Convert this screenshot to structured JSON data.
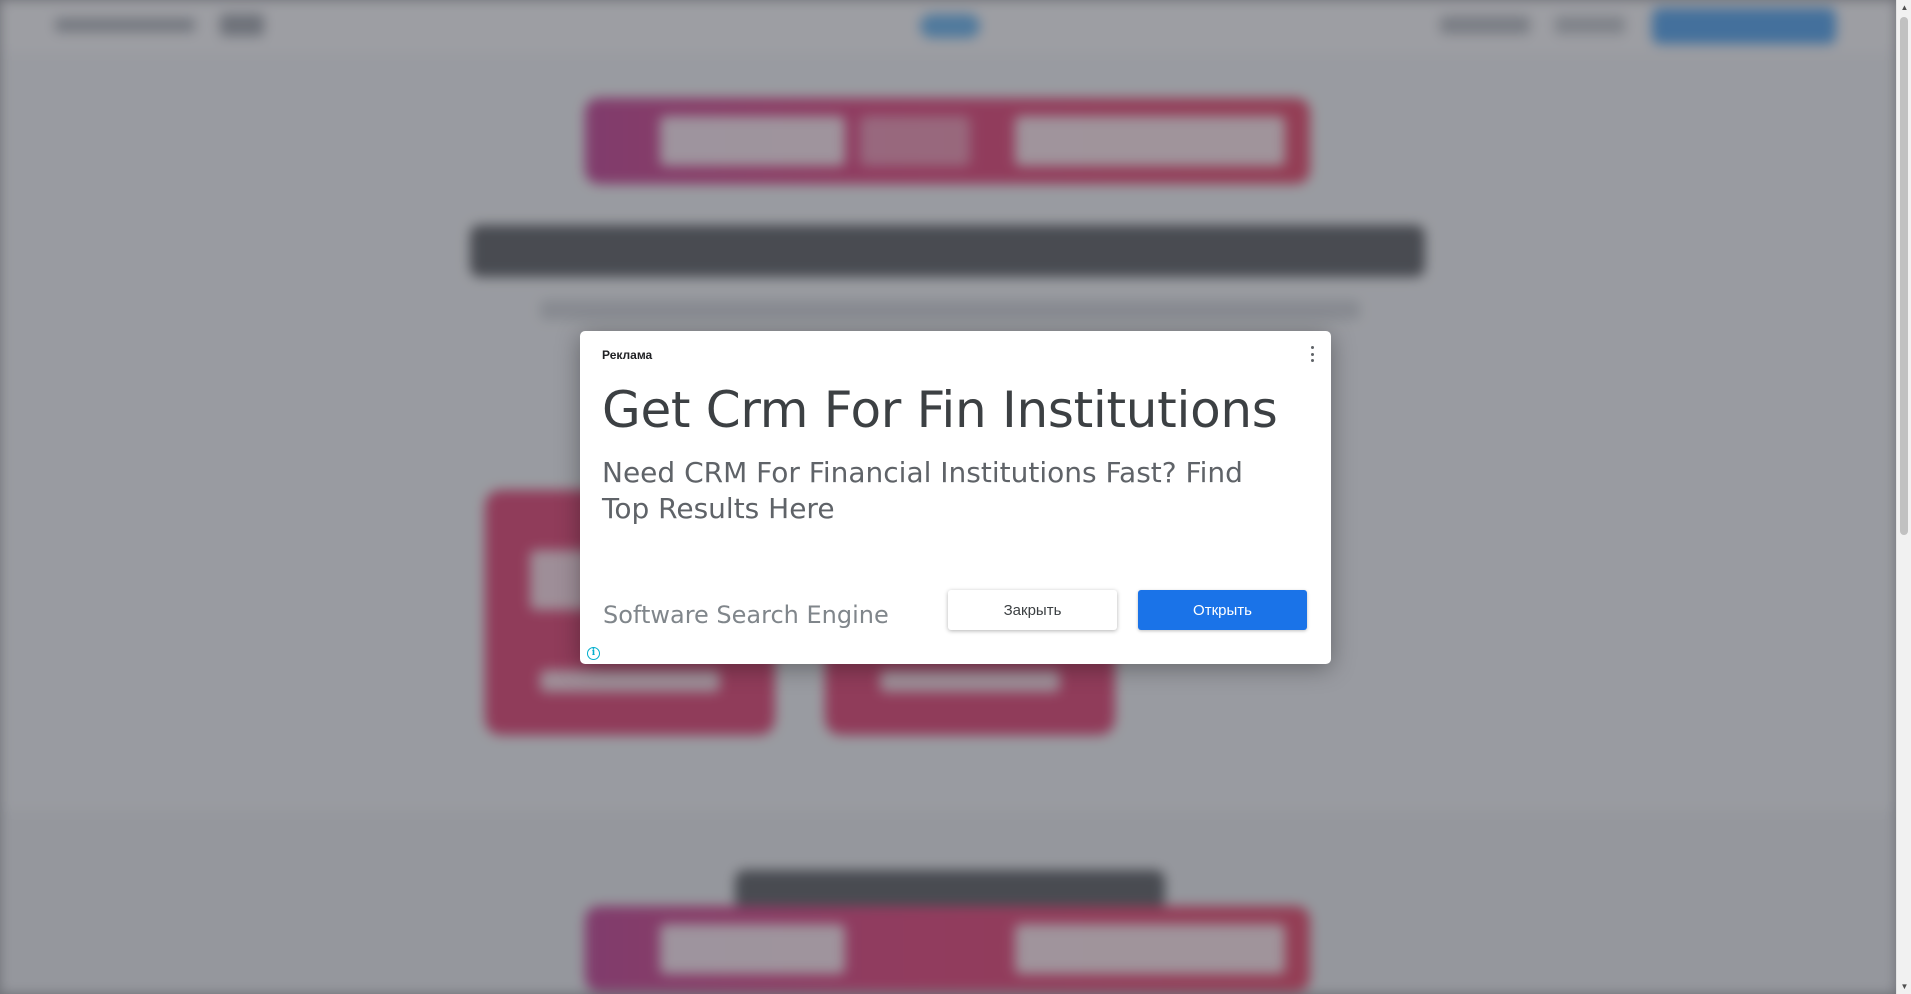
{
  "ad": {
    "label": "Реклама",
    "title": "Get Crm For Fin Institutions",
    "description": "Need CRM For Financial Institutions Fast? Find Top Results Here",
    "advertiser": "Software Search Engine",
    "close_label": "Закрыть",
    "open_label": "Открыть",
    "menu_icon": "more-vert-icon",
    "info_icon": "info-icon"
  },
  "colors": {
    "open_button": "#1a73e8",
    "banner_accent": "#d81b60",
    "info_icon": "#00aecd"
  }
}
